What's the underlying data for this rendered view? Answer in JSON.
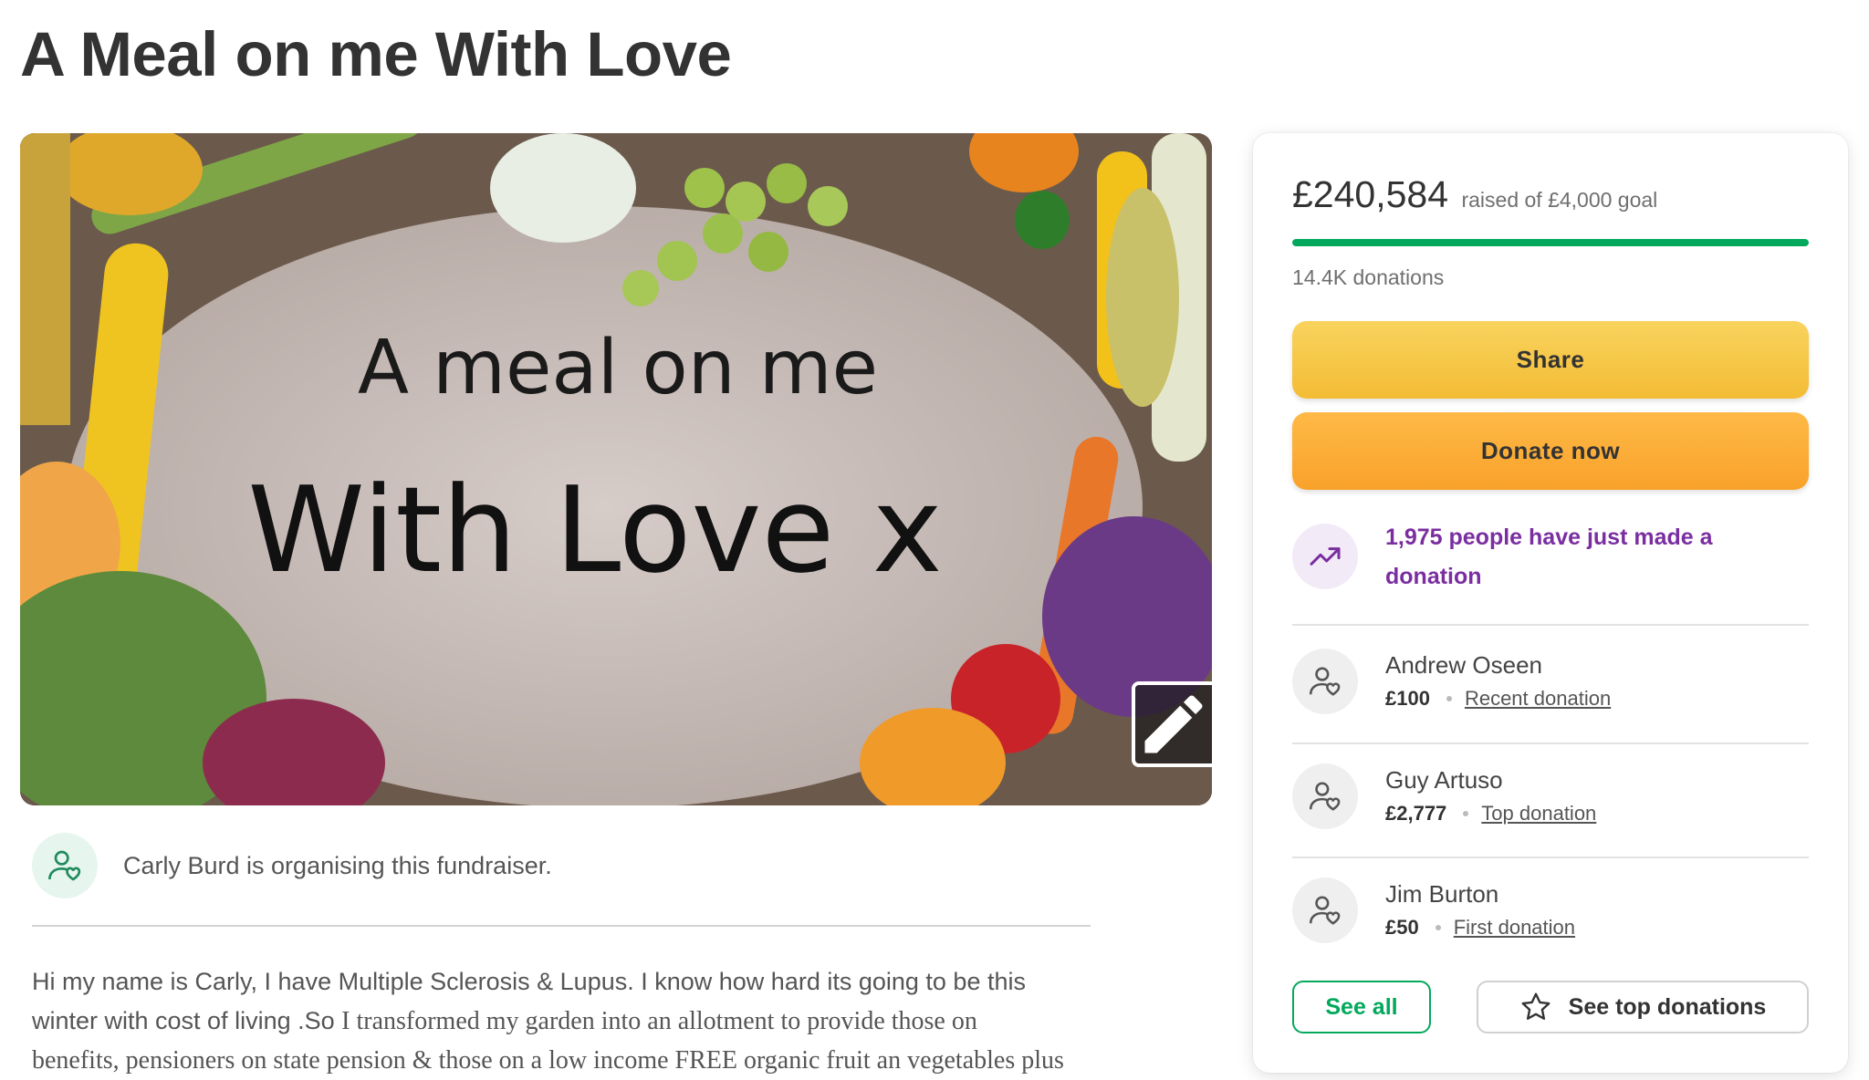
{
  "page": {
    "title": "A Meal on me With Love"
  },
  "hero": {
    "image_text_line1": "A meal on me",
    "image_text_line2": "With Love x",
    "edit_icon": "pencil-icon"
  },
  "organiser": {
    "text": "Carly Burd is organising this fundraiser.",
    "icon": "user-heart-icon"
  },
  "story": {
    "line1": "Hi my name is Carly, I have Multiple Sclerosis & Lupus. I know how hard its going to be this",
    "line2a": "winter with cost of living .So ",
    "line2b": "I transformed my garden into an allotment to provide those on",
    "line3": "benefits, pensioners on state pension & those on a low income FREE organic fruit an vegetables plus"
  },
  "sidebar": {
    "amount": "£240,584",
    "goal": "raised of £4,000 goal",
    "progress_fraction": 1.0,
    "donations_count": "14.4K donations",
    "share_label": "Share",
    "donate_label": "Donate now",
    "trend_text": "1,975 people have just made a donation",
    "donors": [
      {
        "name": "Andrew Oseen",
        "amount": "£100",
        "tag": "Recent donation"
      },
      {
        "name": "Guy Artuso",
        "amount": "£2,777",
        "tag": "Top donation"
      },
      {
        "name": "Jim Burton",
        "amount": "£50",
        "tag": "First donation"
      }
    ],
    "see_all_label": "See all",
    "see_top_label": "See top donations"
  },
  "colors": {
    "green": "#02a95c",
    "share_yellow": "#f6c744",
    "donate_orange": "#fbaa36",
    "trend_purple": "#7a2ea0"
  }
}
